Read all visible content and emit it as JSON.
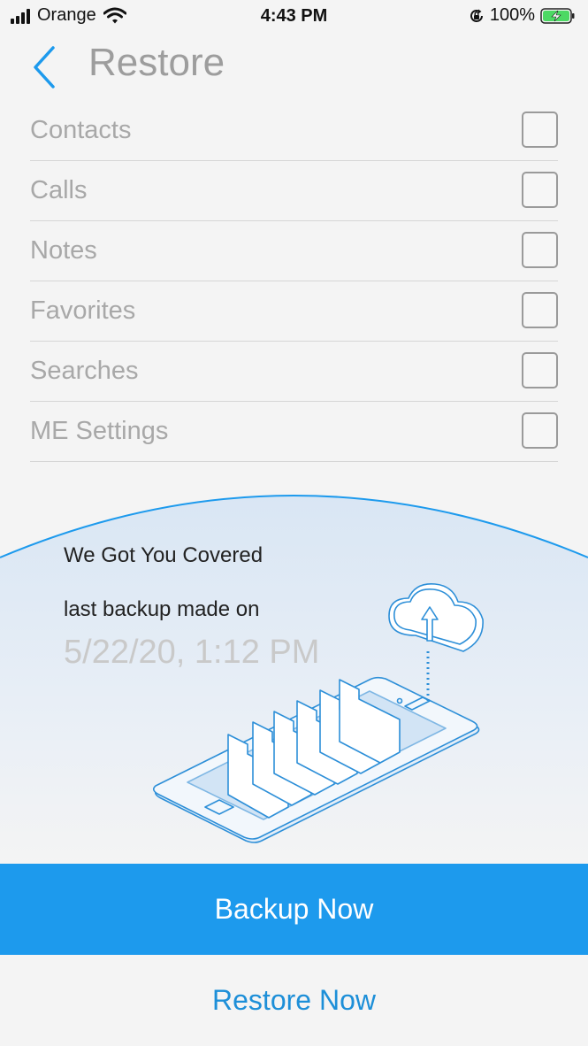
{
  "status_bar": {
    "carrier": "Orange",
    "time": "4:43 PM",
    "battery": "100%",
    "icons": [
      "signal-icon",
      "wifi-icon",
      "orientation-lock-icon",
      "battery-charging-icon"
    ]
  },
  "header": {
    "back_icon": "chevron-left-icon",
    "title": "Restore"
  },
  "items": [
    {
      "label": "Contacts",
      "checked": false
    },
    {
      "label": "Calls",
      "checked": false
    },
    {
      "label": "Notes",
      "checked": false
    },
    {
      "label": "Favorites",
      "checked": false
    },
    {
      "label": "Searches",
      "checked": false
    },
    {
      "label": "ME Settings",
      "checked": false
    }
  ],
  "covered": {
    "heading": "We Got You Covered",
    "subheading": "last backup made on",
    "date": "5/22/20, 1:12 PM",
    "illustration": "phone-backup-cloud-illustration"
  },
  "buttons": {
    "backup": "Backup Now",
    "restore": "Restore Now"
  },
  "colors": {
    "accent": "#1d9aed",
    "restore_text": "#1d8fd8",
    "label_gray": "#a8a8a8",
    "date_gray": "#c9c9c9",
    "battery_green": "#4cd964"
  }
}
